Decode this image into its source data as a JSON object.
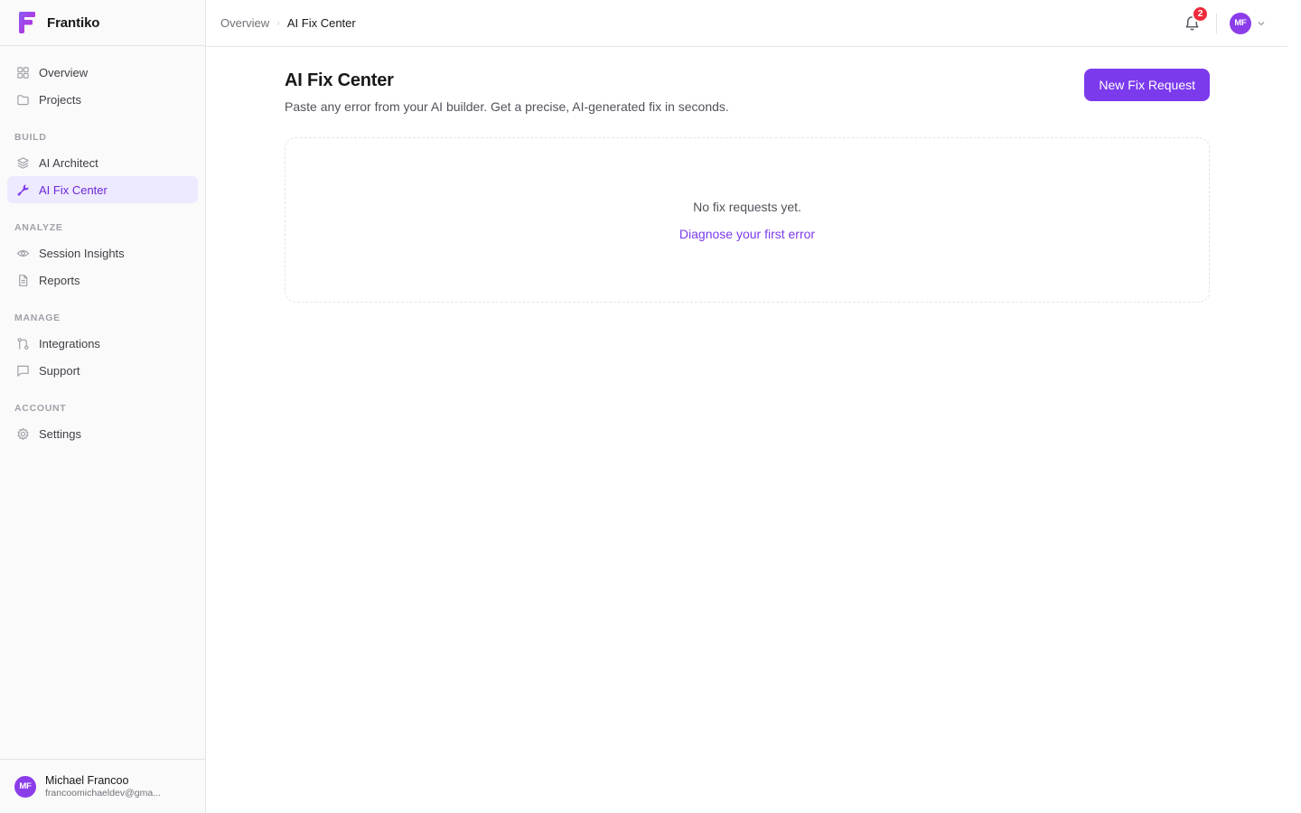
{
  "brand": {
    "name": "Frantiko",
    "logo_color": "#7c3aed"
  },
  "sidebar": {
    "top_items": [
      {
        "label": "Overview",
        "icon": "grid-icon"
      },
      {
        "label": "Projects",
        "icon": "folder-icon"
      }
    ],
    "sections": [
      {
        "label": "BUILD",
        "items": [
          {
            "label": "AI Architect",
            "icon": "layers-icon"
          },
          {
            "label": "AI Fix Center",
            "icon": "wrench-icon",
            "active": true
          }
        ]
      },
      {
        "label": "ANALYZE",
        "items": [
          {
            "label": "Session Insights",
            "icon": "eye-icon"
          },
          {
            "label": "Reports",
            "icon": "document-icon"
          }
        ]
      },
      {
        "label": "MANAGE",
        "items": [
          {
            "label": "Integrations",
            "icon": "git-branch-icon"
          },
          {
            "label": "Support",
            "icon": "message-icon"
          }
        ]
      },
      {
        "label": "ACCOUNT",
        "items": [
          {
            "label": "Settings",
            "icon": "gear-icon"
          }
        ]
      }
    ]
  },
  "user": {
    "initials": "MF",
    "name": "Michael Francoo",
    "email": "francoomichaeldev@gma..."
  },
  "header": {
    "breadcrumb": {
      "parent": "Overview",
      "current": "AI Fix Center"
    },
    "notifications_count": "2",
    "avatar_initials": "MF"
  },
  "main": {
    "title": "AI Fix Center",
    "subtitle": "Paste any error from your AI builder. Get a precise, AI-generated fix in seconds.",
    "primary_button": "New Fix Request",
    "empty_state": {
      "message": "No fix requests yet.",
      "link": "Diagnose your first error"
    }
  },
  "colors": {
    "accent": "#7c3aed",
    "active_bg": "#ede9fe",
    "badge": "#ef2a3a",
    "avatar": "#8b3dea"
  }
}
